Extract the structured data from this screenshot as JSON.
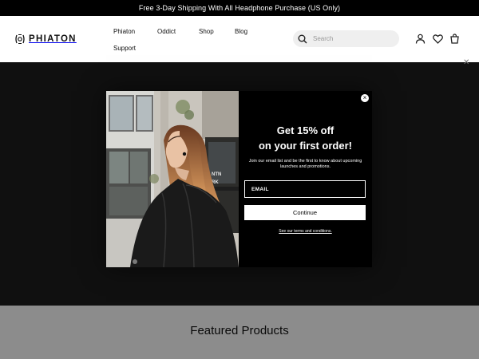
{
  "announcement": {
    "text": "Free 3-Day Shipping With All Headphone Purchase (US Only)"
  },
  "header": {
    "logo_text": "PHIATON",
    "nav": [
      "Phiaton",
      "Oddict",
      "Shop",
      "Blog",
      "Support"
    ],
    "search": {
      "placeholder": "Search"
    },
    "icons": [
      "account-icon",
      "wishlist-heart-icon",
      "cart-icon"
    ]
  },
  "page": {
    "featured_title": "Featured Products"
  },
  "popup": {
    "headline_1": "Get 15% off",
    "headline_2": "on your first order!",
    "subtext": "Join our email list and be the first to know about upcoming launches and promotions.",
    "email_placeholder": "EMAIL",
    "button_label": "Continue",
    "terms_link": "See our terms and conditions.",
    "close_glyph": "×"
  },
  "colors": {
    "announce_bg": "#000000",
    "modal_bg": "#000000",
    "button_bg": "#ffffff",
    "hero_bg": "#1e1e1e"
  }
}
